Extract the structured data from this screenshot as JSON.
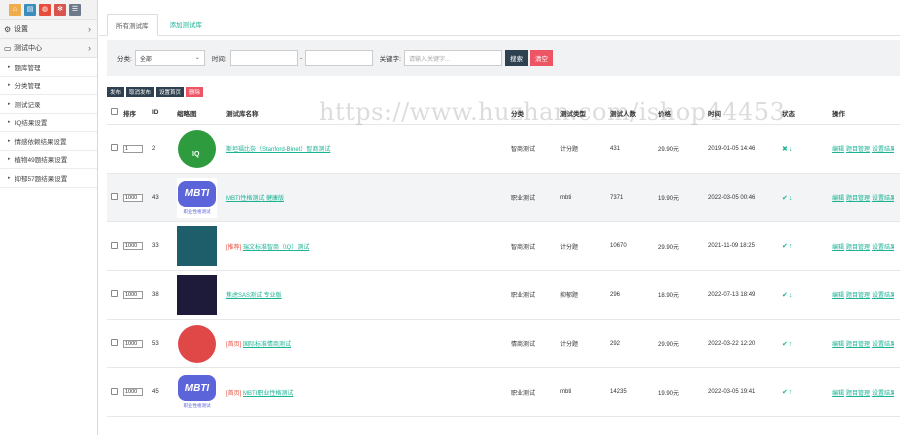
{
  "sidebar": {
    "quick_icons": [
      "home-icon",
      "file-icon",
      "trash-icon",
      "gear-icon",
      "list-icon"
    ],
    "settings_label": "设置",
    "test_center_label": "测试中心",
    "items": [
      {
        "label": "题库管理"
      },
      {
        "label": "分类管理"
      },
      {
        "label": "测试记录"
      },
      {
        "label": "IQ结果设置"
      },
      {
        "label": "情感依赖结果设置"
      },
      {
        "label": "植物49题结果设置"
      },
      {
        "label": "抑郁57题结果设置"
      }
    ]
  },
  "tabs": [
    {
      "label": "所有测试库",
      "active": true
    },
    {
      "label": "添加测试库",
      "active": false
    }
  ],
  "filter": {
    "category_label": "分类:",
    "category_value": "全部",
    "time_label": "时间:",
    "time_separator": "-",
    "keyword_label": "关键字:",
    "keyword_placeholder": "请输入关键字...",
    "search_label": "搜索",
    "clear_label": "清空"
  },
  "actions": {
    "publish": "发布",
    "unpublish": "取消发布",
    "set_home": "设置首页",
    "delete": "删除"
  },
  "table": {
    "headers": {
      "sort": "排序",
      "id": "ID",
      "thumb": "缩略图",
      "name": "测试库名称",
      "category": "分类",
      "type": "测试类型",
      "count": "测试人数",
      "price": "价格",
      "time": "时间",
      "status": "状态",
      "ops": "操作"
    },
    "rows": [
      {
        "sort": "1",
        "id": "2",
        "thumb": "iq",
        "tag": "",
        "name": "斯坦福比奈（Stanford-Binet）智商测试",
        "category": "智商测试",
        "type": "计分题",
        "count": "431",
        "price": "29.90元",
        "time": "2019-01-05 14:46",
        "status_icon": "cross-icon",
        "status_dir": "down-arrow-icon"
      },
      {
        "sort": "1000",
        "id": "43",
        "thumb": "mbti",
        "tag": "",
        "name": "MBTI性格测试 健康版",
        "category": "职业测试",
        "type": "mbti",
        "count": "7371",
        "price": "19.90元",
        "time": "2022-03-05 00:46",
        "status_icon": "check-icon",
        "status_dir": "down-arrow-icon"
      },
      {
        "sort": "1000",
        "id": "33",
        "thumb": "bulb",
        "tag": "[推荐]",
        "name": "瑞文标准智商（IQ）测试",
        "category": "智商测试",
        "type": "计分题",
        "count": "10670",
        "price": "29.90元",
        "time": "2021-11-09 18:25",
        "status_icon": "check-icon",
        "status_dir": "up-arrow-icon"
      },
      {
        "sort": "1000",
        "id": "38",
        "thumb": "dark",
        "tag": "",
        "name": "焦虑SAS测试 专业版",
        "category": "职业测试",
        "type": "抑郁题",
        "count": "296",
        "price": "18.90元",
        "time": "2022-07-13 18:49",
        "status_icon": "check-icon",
        "status_dir": "down-arrow-icon"
      },
      {
        "sort": "1000",
        "id": "53",
        "thumb": "circle",
        "tag": "[首页]",
        "name": "国际标准情商测试",
        "category": "情商测试",
        "type": "计分题",
        "count": "292",
        "price": "29.90元",
        "time": "2022-03-22 12:20",
        "status_icon": "check-icon",
        "status_dir": "up-arrow-icon"
      },
      {
        "sort": "1000",
        "id": "45",
        "thumb": "mbti",
        "tag": "[首页]",
        "name": "MBTI职业性格测试",
        "category": "职业测试",
        "type": "mbti",
        "count": "14235",
        "price": "19.90元",
        "time": "2022-03-05 19:41",
        "status_icon": "check-icon",
        "status_dir": "up-arrow-icon"
      }
    ],
    "ops": [
      "编辑",
      "题目管理",
      "设置结果"
    ],
    "mbti_text": "MBTI",
    "mbti_sub": "职业性格测试",
    "iq_text": "IQ"
  },
  "watermark": "https://www.huzhan.com/ishop44453"
}
